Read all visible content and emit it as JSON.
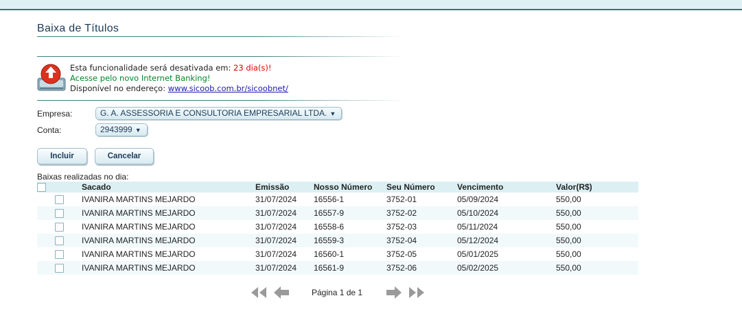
{
  "page": {
    "title": "Baixa de Títulos"
  },
  "notice": {
    "line1_prefix": "Esta funcionalidade será desativada em: ",
    "line1_days": "23 dia(s)!",
    "line2": "Acesse pelo novo Internet Banking!",
    "line3_prefix": "Disponível no endereço: ",
    "line3_link": "www.sicoob.com.br/sicoobnet/"
  },
  "form": {
    "empresa_label": "Empresa:",
    "empresa_value": "G. A. ASSESSORIA E CONSULTORIA EMPRESARIAL LTDA.",
    "conta_label": "Conta:",
    "conta_value": "2943999",
    "dropdown_arrow": "▼"
  },
  "buttons": {
    "incluir": "Incluir",
    "cancelar": "Cancelar"
  },
  "table": {
    "section_label": "Baixas realizadas no dia:",
    "headers": [
      "Sacado",
      "Emissão",
      "Nosso Número",
      "Seu Número",
      "Vencimento",
      "Valor(R$)"
    ],
    "rows": [
      [
        "IVANIRA MARTINS MEJARDO",
        "31/07/2024",
        "16556-1",
        "3752-01",
        "05/09/2024",
        "550,00"
      ],
      [
        "IVANIRA MARTINS MEJARDO",
        "31/07/2024",
        "16557-9",
        "3752-02",
        "05/10/2024",
        "550,00"
      ],
      [
        "IVANIRA MARTINS MEJARDO",
        "31/07/2024",
        "16558-6",
        "3752-03",
        "05/11/2024",
        "550,00"
      ],
      [
        "IVANIRA MARTINS MEJARDO",
        "31/07/2024",
        "16559-3",
        "3752-04",
        "05/12/2024",
        "550,00"
      ],
      [
        "IVANIRA MARTINS MEJARDO",
        "31/07/2024",
        "16560-1",
        "3752-05",
        "05/01/2025",
        "550,00"
      ],
      [
        "IVANIRA MARTINS MEJARDO",
        "31/07/2024",
        "16561-9",
        "3752-06",
        "05/02/2025",
        "550,00"
      ]
    ]
  },
  "pager": {
    "text": "Página 1 de 1",
    "icons": [
      "first-page-icon",
      "previous-page-icon",
      "next-page-icon",
      "last-page-icon"
    ]
  },
  "colors": {
    "accent": "#3f7f7f",
    "header_bg": "#dcf0f4",
    "warning_red": "#e00000",
    "notice_green": "#00882a",
    "link_blue": "#1a1ab0"
  }
}
